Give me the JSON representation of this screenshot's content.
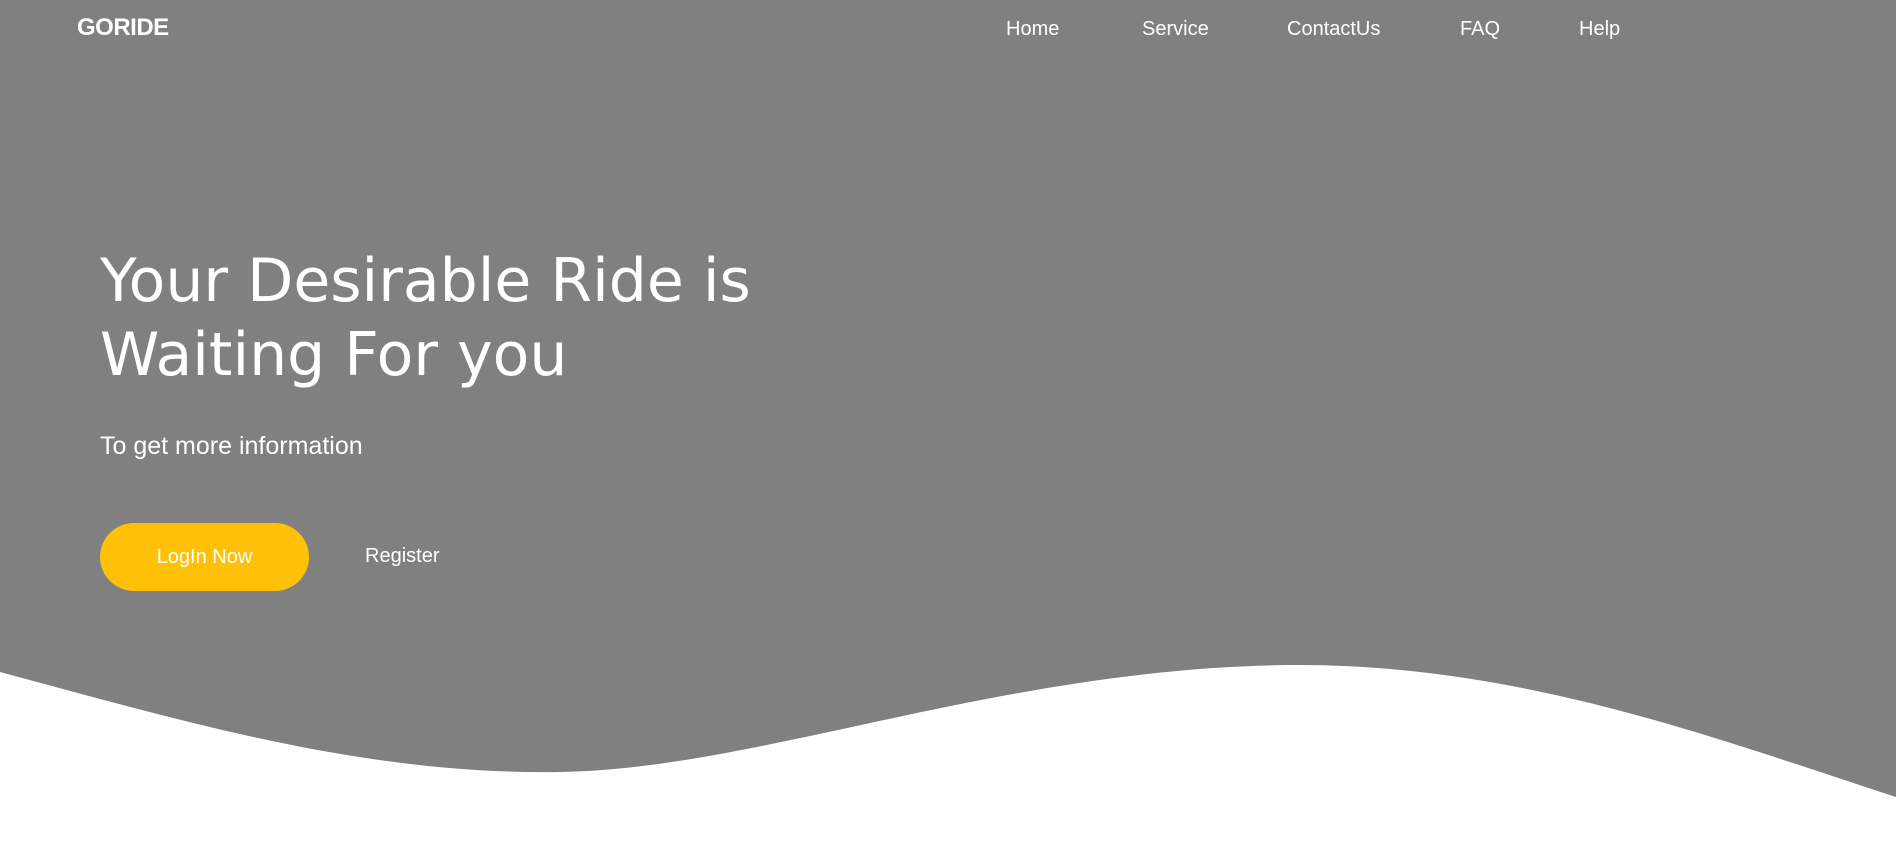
{
  "brand": {
    "logo_text": "GORIDE"
  },
  "nav": {
    "home": "Home",
    "service": "Service",
    "contact": "ContactUs",
    "faq": "FAQ",
    "help": "Help"
  },
  "hero": {
    "title": "Your Desirable Ride is Waiting For you",
    "subtitle": "To get more information",
    "login_label": "LogIn Now",
    "register_label": "Register"
  },
  "colors": {
    "background": "#808080",
    "accent": "#ffc107",
    "text": "#ffffff",
    "wave_fill": "#ffffff"
  }
}
